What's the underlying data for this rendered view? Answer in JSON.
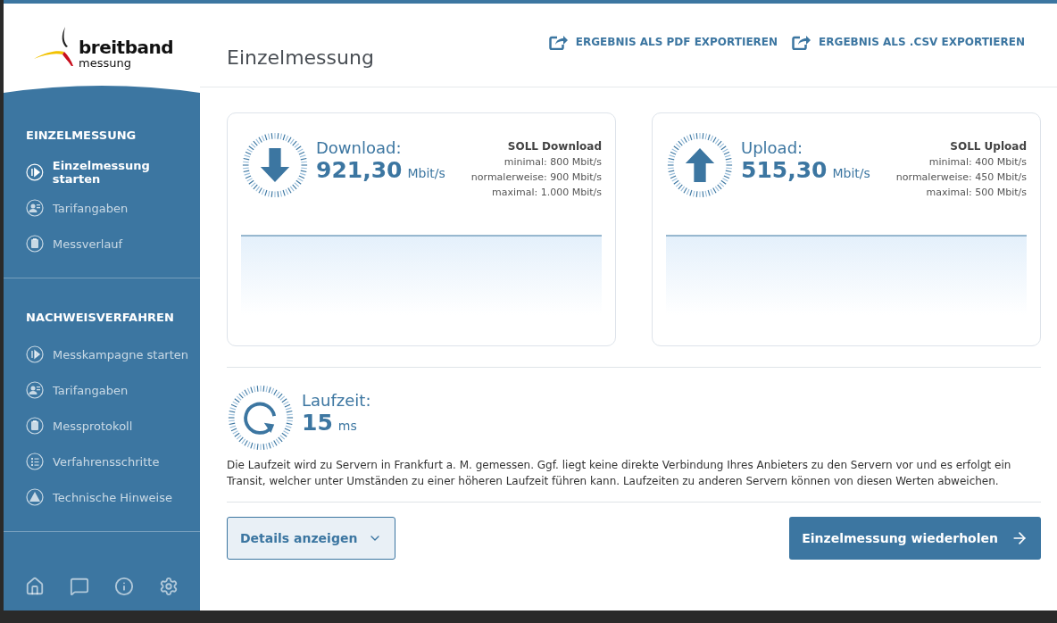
{
  "logo": {
    "word_1": "breitband",
    "word_2": "messung"
  },
  "sidebar": {
    "sections": [
      {
        "title": "EINZELMESSUNG",
        "items": [
          {
            "label": "Einzelmessung starten",
            "kind": "play",
            "selected": true
          },
          {
            "label": "Tarifangaben",
            "kind": "person",
            "selected": false
          },
          {
            "label": "Messverlauf",
            "kind": "clipboard",
            "selected": false
          }
        ]
      },
      {
        "title": "NACHWEISVERFAHREN",
        "items": [
          {
            "label": "Messkampagne starten",
            "kind": "play",
            "selected": false
          },
          {
            "label": "Tarifangaben",
            "kind": "person",
            "selected": false
          },
          {
            "label": "Messprotokoll",
            "kind": "clipboard",
            "selected": false
          },
          {
            "label": "Verfahrensschritte",
            "kind": "list",
            "selected": false
          },
          {
            "label": "Technische Hinweise",
            "kind": "warning",
            "selected": false
          }
        ]
      }
    ],
    "footer_icons": [
      {
        "kind": "home"
      },
      {
        "kind": "chat"
      },
      {
        "kind": "info"
      },
      {
        "kind": "settings"
      }
    ]
  },
  "header": {
    "title": "Einzelmessung",
    "actions": [
      "ERGEBNIS ALS PDF EXPORTIEREN",
      "ERGEBNIS ALS .CSV EXPORTIEREN"
    ]
  },
  "cards": [
    {
      "kind": "down",
      "label": "Download:",
      "value": "921,30",
      "unit": "Mbit/s",
      "target_title": "SOLL Download",
      "targets": [
        "minimal: 800 Mbit/s",
        "normalerweise: 900 Mbit/s",
        "maximal: 1.000 Mbit/s"
      ]
    },
    {
      "kind": "up",
      "label": "Upload:",
      "value": "515,30",
      "unit": "Mbit/s",
      "target_title": "SOLL Upload",
      "targets": [
        "minimal: 400 Mbit/s",
        "normalerweise: 450 Mbit/s",
        "maximal: 500 Mbit/s"
      ]
    }
  ],
  "latency": {
    "label": "Laufzeit:",
    "value": "15",
    "unit": "ms",
    "note": "Die Laufzeit wird zu Servern in Frankfurt a. M. gemessen. Ggf. liegt keine direkte Verbindung Ihres Anbieters zu den Servern vor und es erfolgt ein Transit, welcher unter Umständen zu einer höheren Laufzeit führen kann. Laufzeiten zu anderen Servern können von diesen Werten abweichen."
  },
  "buttons": {
    "details": "Details anzeigen",
    "repeat": "Einzelmessung wiederholen"
  }
}
